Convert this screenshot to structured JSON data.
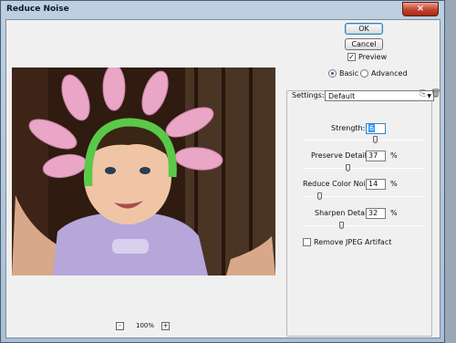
{
  "window": {
    "title": "Reduce Noise",
    "close_glyph": "×"
  },
  "buttons": {
    "ok": "OK",
    "cancel": "Cancel"
  },
  "preview_toggle": {
    "label": "Preview",
    "checked": true
  },
  "mode": {
    "basic": "Basic",
    "advanced": "Advanced",
    "selected": "basic"
  },
  "settings": {
    "label": "Settings:",
    "value": "Default"
  },
  "params": {
    "strength": {
      "label": "Strength:",
      "value": "6",
      "level": 0.6
    },
    "preserve_details": {
      "label": "Preserve Details:",
      "value": "37",
      "unit": "%",
      "level": 0.37
    },
    "reduce_color_noise": {
      "label": "Reduce Color Noise:",
      "value": "14",
      "unit": "%",
      "level": 0.14
    },
    "sharpen_details": {
      "label": "Sharpen Details:",
      "value": "32",
      "unit": "%",
      "level": 0.32
    }
  },
  "jpeg_artifact": {
    "label": "Remove JPEG Artifact",
    "checked": false
  },
  "zoom": {
    "level": "100%",
    "minus": "-",
    "plus": "+"
  },
  "icons": {
    "save_settings": "save-settings-icon",
    "delete_settings": "trash-icon"
  }
}
